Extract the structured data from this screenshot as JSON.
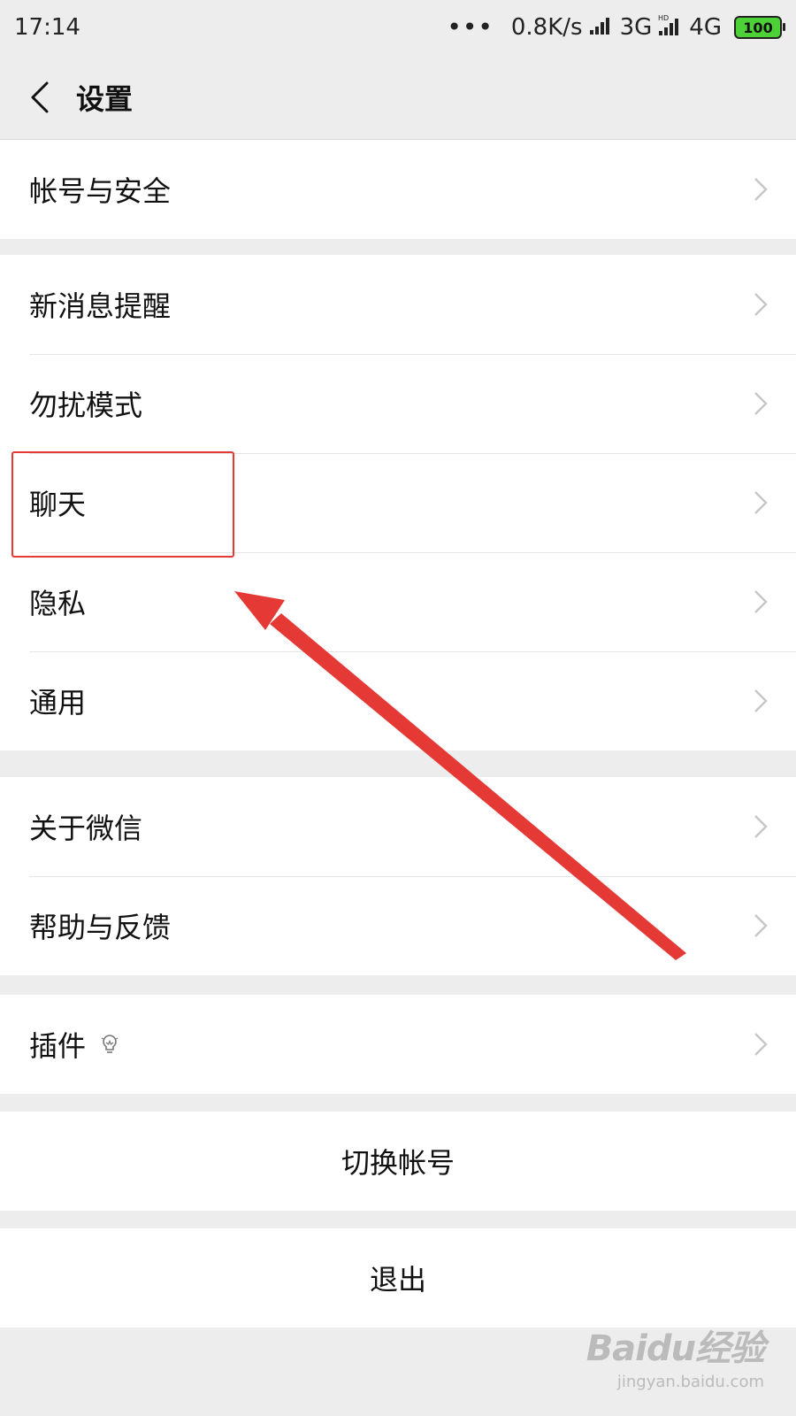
{
  "status_bar": {
    "time": "17:14",
    "dots": "•••",
    "speed": "0.8K/s",
    "network_3g": "3G",
    "network_4g": "4G",
    "battery": "100",
    "battery_color": "#4cd137"
  },
  "header": {
    "title": "设置"
  },
  "settings": {
    "group1": [
      {
        "label": "帐号与安全"
      }
    ],
    "group2": [
      {
        "label": "新消息提醒"
      },
      {
        "label": "勿扰模式"
      },
      {
        "label": "聊天"
      },
      {
        "label": "隐私"
      },
      {
        "label": "通用"
      }
    ],
    "group3": [
      {
        "label": "关于微信"
      },
      {
        "label": "帮助与反馈"
      }
    ],
    "group4": [
      {
        "label": "插件",
        "icon": "lightbulb-icon"
      }
    ]
  },
  "actions": {
    "switch_account": "切换帐号",
    "logout": "退出"
  },
  "annotation": {
    "color": "#e53935"
  },
  "watermark": {
    "logo": "Baidu经验",
    "sub": "jingyan.baidu.com"
  }
}
